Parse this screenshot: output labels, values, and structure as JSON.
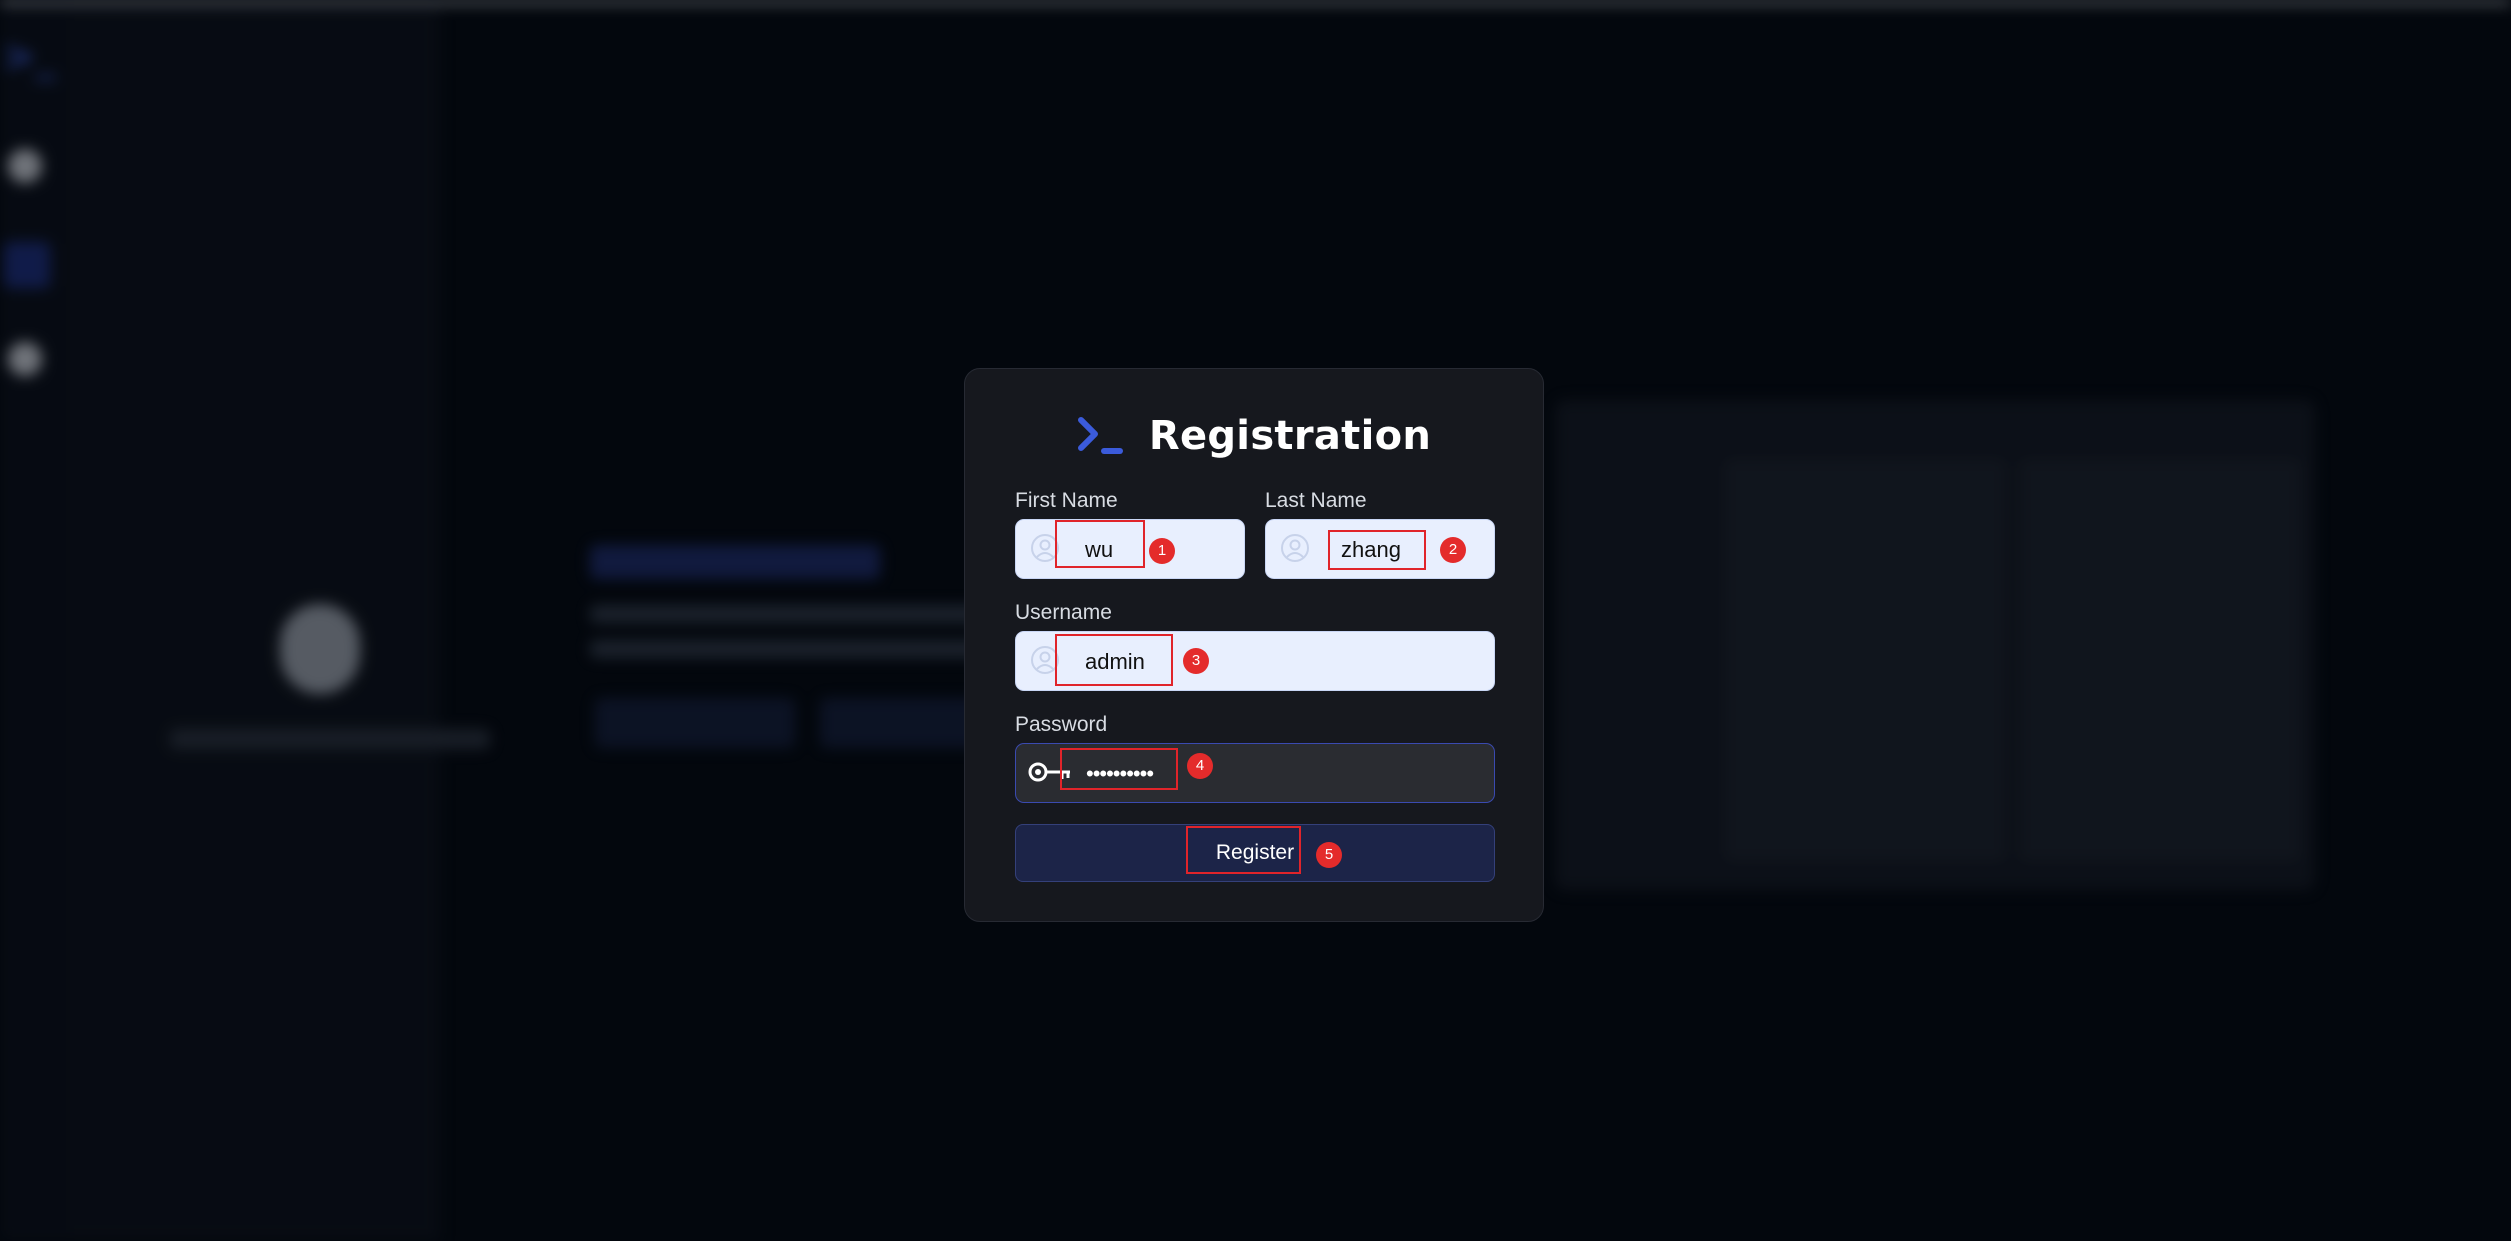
{
  "modal": {
    "title": "Registration",
    "first_name": {
      "label": "First Name",
      "value": "wu"
    },
    "last_name": {
      "label": "Last Name",
      "value": "zhang"
    },
    "username": {
      "label": "Username",
      "value": "admin"
    },
    "password": {
      "label": "Password",
      "value": "••••••••••"
    },
    "register_label": "Register"
  },
  "annotations": [
    "1",
    "2",
    "3",
    "4",
    "5"
  ],
  "colors": {
    "accent": "#3b5bdb",
    "modal_bg": "#16181e",
    "input_bg": "#e8effe",
    "annotation": "#e42b2b"
  },
  "icons": [
    "terminal-logo-icon",
    "user-icon",
    "key-icon"
  ]
}
